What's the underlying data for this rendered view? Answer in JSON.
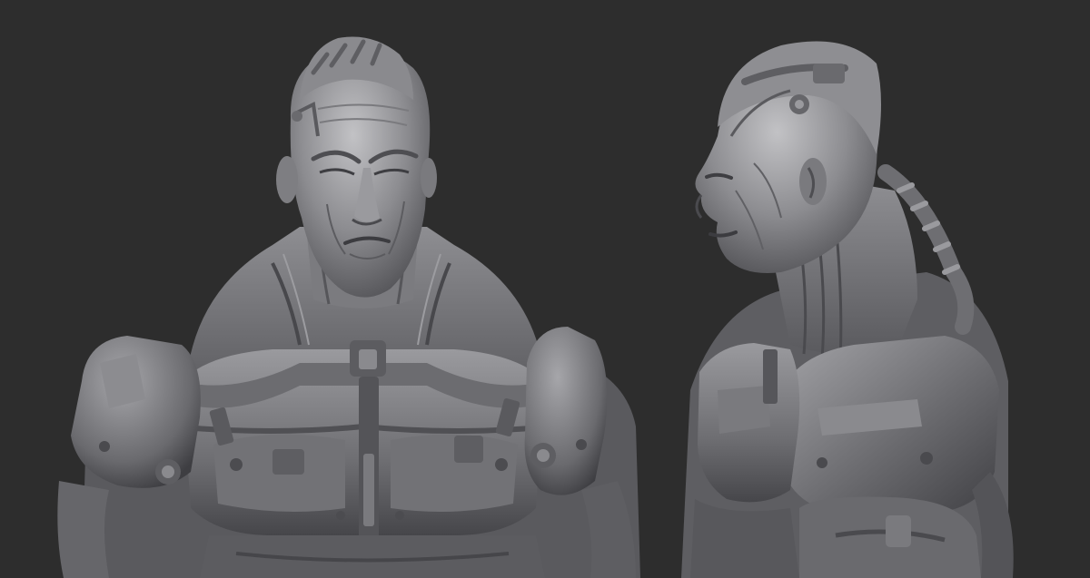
{
  "scene": {
    "background_color": "#2d2d2d",
    "clay_light": "#b3b3b6",
    "clay_mid": "#7d7d81",
    "clay_dark": "#4a4a4e",
    "clay_shadow": "#2a2a2d",
    "subjects": [
      {
        "view": "front",
        "icon": "cyborg-bust-front-icon"
      },
      {
        "view": "side",
        "icon": "cyborg-bust-side-icon"
      }
    ]
  }
}
